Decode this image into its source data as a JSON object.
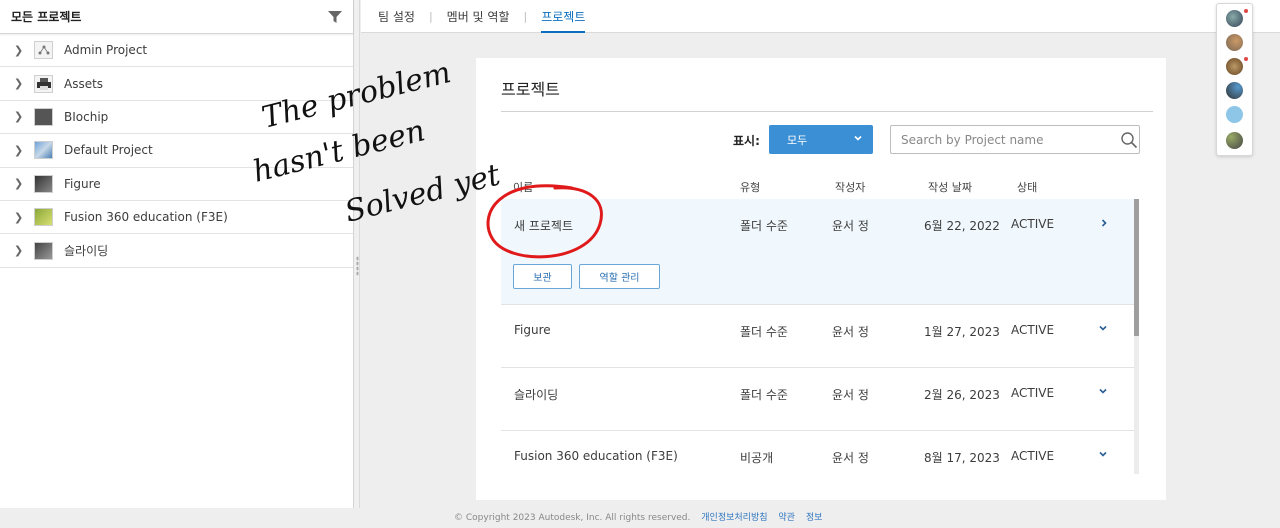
{
  "sidebar": {
    "title": "모든 프로젝트",
    "items": [
      {
        "label": "Admin Project",
        "icon": "hub-icon"
      },
      {
        "label": "Assets",
        "icon": "printer-icon"
      },
      {
        "label": "BIochip",
        "icon": "image-thumb-icon"
      },
      {
        "label": "Default Project",
        "icon": "image-thumb-icon"
      },
      {
        "label": "Figure",
        "icon": "image-thumb-icon"
      },
      {
        "label": "Fusion 360 education (F3E)",
        "icon": "image-thumb-icon"
      },
      {
        "label": "슬라이딩",
        "icon": "image-thumb-icon"
      }
    ]
  },
  "tabs": [
    {
      "label": "팀 설정"
    },
    {
      "label": "멤버 및 역할"
    },
    {
      "label": "프로젝트",
      "active": true
    }
  ],
  "card": {
    "title": "프로젝트",
    "show_label": "표시:",
    "dropdown_value": "모두",
    "search_placeholder": "Search by Project name"
  },
  "table": {
    "headers": {
      "name": "이름",
      "type": "유형",
      "author": "작성자",
      "date": "작성 날짜",
      "status": "상태"
    },
    "rows": [
      {
        "name": "새 프로젝트",
        "type": "폴더 수준",
        "author": "윤서 정",
        "date": "6월 22, 2022",
        "status": "ACTIVE",
        "expanded": true
      },
      {
        "name": "Figure",
        "type": "폴더 수준",
        "author": "윤서 정",
        "date": "1월 27, 2023",
        "status": "ACTIVE"
      },
      {
        "name": "슬라이딩",
        "type": "폴더 수준",
        "author": "윤서 정",
        "date": "2월 26, 2023",
        "status": "ACTIVE"
      },
      {
        "name": "Fusion 360 education (F3E)",
        "type": "비공개",
        "author": "윤서 정",
        "date": "8월 17, 2023",
        "status": "ACTIVE"
      }
    ],
    "actions": {
      "archive": "보관",
      "manage_roles": "역할 관리"
    }
  },
  "annotation": {
    "line1": "The problem",
    "line2": "hasn't been",
    "line3": "Solved yet",
    "color": "#e0191b"
  },
  "footer": {
    "copyright": "© Copyright 2023 Autodesk, Inc. All rights reserved.",
    "privacy": "개인정보처리방침",
    "terms": "약관",
    "info": "정보"
  }
}
